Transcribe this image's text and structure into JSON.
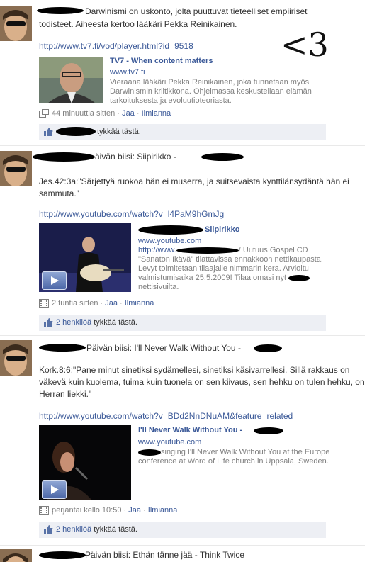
{
  "posts": [
    {
      "text": "Darwinismi on uskonto, jolta puuttuvat tieteelliset empiiriset",
      "text2": "todisteet. Aiheesta kertoo lääkäri Pekka Reinikainen.",
      "link": "http://www.tv7.fi/vod/player.html?id=9518",
      "card_title": "TV7 - When content matters",
      "card_domain": "www.tv7.fi",
      "card_desc": "Vieraana lääkäri Pekka Reinikainen, joka tunnetaan myös Darwinismin kriitikkona. Ohjelmassa keskustellaan elämän tarkoituksesta ja evoluutioteoriasta.",
      "time": "44 minuuttia sitten",
      "share": "Jaa",
      "report": "Ilmianna",
      "likes": "tykkää tästä.",
      "annotation": "<3"
    },
    {
      "text": "äivän biisi: Siipirikko -",
      "quote": "Jes.42:3a:\"Särjettyä ruokoa hän ei muserra, ja suitsevaista kynttilänsydäntä hän ei sammuta.\"",
      "link": "http://www.youtube.com/watch?v=l4PaM9hGmJg",
      "card_title": "Siipirikko",
      "card_domain": "www.youtube.com",
      "card_desc_link": "http://www.",
      "card_desc_after": "/ Uutuus Gospel CD \"Sanaton Ikävä\" tilattavissa ennakkoon nettikaupasta. Levyt toimitetaan tilaajalle nimmarin kera. Arvioitu valmistumisaika 25.5.2009! Tilaa omasi nyt",
      "card_desc_end": "nettisivuilta.",
      "time": "2 tuntia sitten",
      "share": "Jaa",
      "report": "Ilmianna",
      "likes_count": "2 henkilöä",
      "likes": "tykkää tästä."
    },
    {
      "text": "Päivän biisi: I'll Never Walk Without You -",
      "quote": "Kork.8:6:\"Pane minut sinetiksi sydämellesi, sinetiksi käsivarrellesi. Sillä rakkaus on väkevä kuin kuolema, tuima kuin tuonela on sen kiivaus, sen hehku on tulen hehku, on Herran liekki.\"",
      "link": "http://www.youtube.com/watch?v=BDd2NnDNuAM&feature=related",
      "card_title": "I'll Never Walk Without You -",
      "card_domain": "www.youtube.com",
      "card_desc": "singing I'll Never Walk Without You at the Europe conference at Word of Life church in Uppsala, Sweden.",
      "time": "perjantai kello 10:50",
      "share": "Jaa",
      "report": "Ilmianna",
      "likes_count": "2 henkilöä",
      "likes": "tykkää tästä."
    },
    {
      "text": "Päivän biisi: Ethän tänne jää - Think Twice"
    }
  ],
  "colors": {
    "link": "#3b5998",
    "muted": "#808080",
    "likebar": "#edeff4"
  }
}
